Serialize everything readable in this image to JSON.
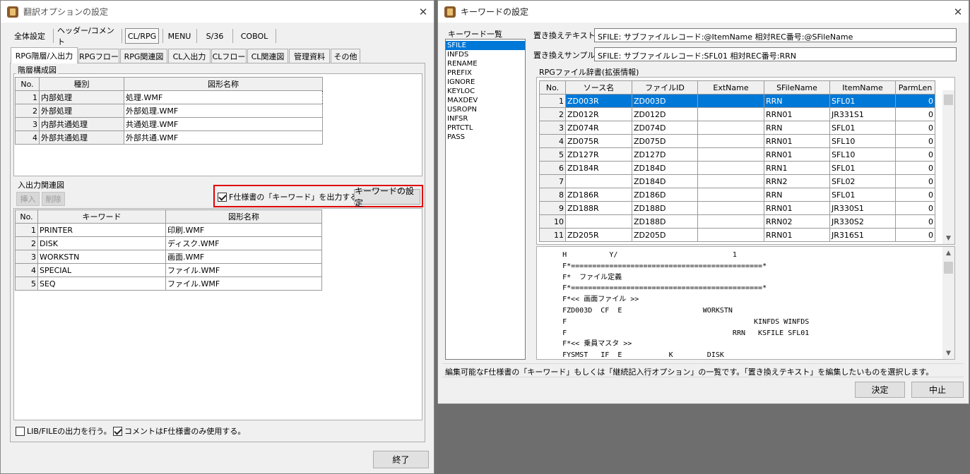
{
  "left_window": {
    "title": "翻訳オプションの設定",
    "top_buttons": [
      "全体設定",
      "ヘッダー/コメント",
      "CL/RPG",
      "MENU",
      "S/36",
      "COBOL"
    ],
    "tabs": [
      "RPG階層/入出力",
      "RPGフロー",
      "RPG関連図",
      "CL入出力",
      "CLフロー",
      "CL関連図",
      "管理資料",
      "その他"
    ],
    "hierarchy": {
      "label": "階層構成図",
      "headers": [
        "No.",
        "種別",
        "図形名称"
      ],
      "rows": [
        {
          "no": "1",
          "kind": "内部処理",
          "file": "処理.WMF"
        },
        {
          "no": "2",
          "kind": "外部処理",
          "file": "外部処理.WMF"
        },
        {
          "no": "3",
          "kind": "内部共通処理",
          "file": "共通処理.WMF"
        },
        {
          "no": "4",
          "kind": "外部共通処理",
          "file": "外部共通.WMF"
        }
      ]
    },
    "io": {
      "label": "入出力関連図",
      "insert_label": "挿入",
      "delete_label": "削除",
      "fspec_check_label": "F仕様書の「キーワード」を出力する。",
      "keyword_button": "キーワードの設定",
      "headers": [
        "No.",
        "キーワード",
        "図形名称"
      ],
      "rows": [
        {
          "no": "1",
          "keyword": "PRINTER",
          "file": "印刷.WMF"
        },
        {
          "no": "2",
          "keyword": "DISK",
          "file": "ディスク.WMF"
        },
        {
          "no": "3",
          "keyword": "WORKSTN",
          "file": "画面.WMF"
        },
        {
          "no": "4",
          "keyword": "SPECIAL",
          "file": "ファイル.WMF"
        },
        {
          "no": "5",
          "keyword": "SEQ",
          "file": "ファイル.WMF"
        }
      ]
    },
    "libfile_label": "LIB/FILEの出力を行う。",
    "comment_label": "コメントはF仕様書のみ使用する。",
    "close_button": "終了",
    "highlight_color": "#e00000"
  },
  "right_window": {
    "title": "キーワードの設定",
    "list_title": "キーワード一覧",
    "keywords": [
      "SFILE",
      "INFDS",
      "RENAME",
      "PREFIX",
      "IGNORE",
      "KEYLOC",
      "MAXDEV",
      "USROPN",
      "INFSR",
      "PRTCTL",
      "PASS"
    ],
    "replace_text_label": "置き換えテキスト",
    "replace_text_value": "SFILE: サブファイルレコード:@ItemName 相対REC番号:@SFileName",
    "replace_sample_label": "置き換えサンプル",
    "replace_sample_value": "SFILE: サブファイルレコード:SFL01 相対REC番号:RRN",
    "dict_label": "RPGファイル辞書(拡張情報)",
    "dict_headers": [
      "No.",
      "ソース名",
      "ファイルID",
      "ExtName",
      "SFileName",
      "ItemName",
      "ParmLen"
    ],
    "dict_rows": [
      {
        "no": "1",
        "src": "ZD003R",
        "fid": "ZD003D",
        "ext": "",
        "sfile": "RRN",
        "item": "SFL01",
        "parm": "0"
      },
      {
        "no": "2",
        "src": "ZD012R",
        "fid": "ZD012D",
        "ext": "",
        "sfile": "RRN01",
        "item": "JR331S1",
        "parm": "0"
      },
      {
        "no": "3",
        "src": "ZD074R",
        "fid": "ZD074D",
        "ext": "",
        "sfile": "RRN",
        "item": "SFL01",
        "parm": "0"
      },
      {
        "no": "4",
        "src": "ZD075R",
        "fid": "ZD075D",
        "ext": "",
        "sfile": "RRN01",
        "item": "SFL10",
        "parm": "0"
      },
      {
        "no": "5",
        "src": "ZD127R",
        "fid": "ZD127D",
        "ext": "",
        "sfile": "RRN01",
        "item": "SFL10",
        "parm": "0"
      },
      {
        "no": "6",
        "src": "ZD184R",
        "fid": "ZD184D",
        "ext": "",
        "sfile": "RRN1",
        "item": "SFL01",
        "parm": "0"
      },
      {
        "no": "7",
        "src": "",
        "fid": "ZD184D",
        "ext": "",
        "sfile": "RRN2",
        "item": "SFL02",
        "parm": "0"
      },
      {
        "no": "8",
        "src": "ZD186R",
        "fid": "ZD186D",
        "ext": "",
        "sfile": "RRN",
        "item": "SFL01",
        "parm": "0"
      },
      {
        "no": "9",
        "src": "ZD188R",
        "fid": "ZD188D",
        "ext": "",
        "sfile": "RRN01",
        "item": "JR330S1",
        "parm": "0"
      },
      {
        "no": "10",
        "src": "",
        "fid": "ZD188D",
        "ext": "",
        "sfile": "RRN02",
        "item": "JR330S2",
        "parm": "0"
      },
      {
        "no": "11",
        "src": "ZD205R",
        "fid": "ZD205D",
        "ext": "",
        "sfile": "RRN01",
        "item": "JR316S1",
        "parm": "0"
      }
    ],
    "source_lines": [
      "     H          Y/                           1",
      "     F*=============================================*",
      "     F*  ファイル定義",
      "     F*=============================================*",
      "     F*<< 画面ファイル >>",
      "     FZD003D  CF  E                   WORKSTN",
      "     F                                            KINFDS WINFDS",
      "     F                                       RRN   KSFILE SFL01",
      "     F*<< 乗員マスタ >>",
      "     FYSMST   IF  E           K        DISK"
    ],
    "status_text": "編集可能なF仕様書の「キーワード」もしくは「継続記入行オプション」の一覧です。「置き換えテキスト」を編集したいものを選択します。",
    "ok_button": "決定",
    "cancel_button": "中止"
  }
}
